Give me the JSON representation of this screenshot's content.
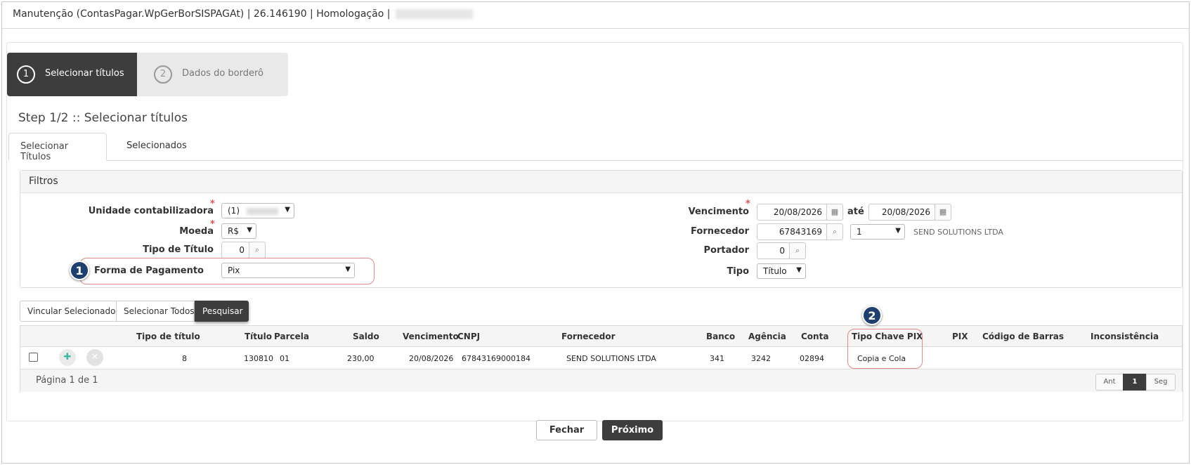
{
  "window": {
    "title": "Manutenção (ContasPagar.WpGerBorSISPAGAt) | 26.146190 | Homologação |"
  },
  "steps": [
    {
      "number": "1",
      "label": "Selecionar títulos"
    },
    {
      "number": "2",
      "label": "Dados do borderô"
    }
  ],
  "step_heading": "Step 1/2 :: Selecionar títulos",
  "tabs": [
    {
      "label": "Selecionar Títulos",
      "active": true
    },
    {
      "label": "Selecionados",
      "active": false
    }
  ],
  "filters": {
    "title": "Filtros",
    "required_mark": "*",
    "unidade": {
      "label": "Unidade contabilizadora",
      "value": "(1)"
    },
    "moeda": {
      "label": "Moeda",
      "value": "R$"
    },
    "tipo_titulo": {
      "label": "Tipo de Título",
      "value": "0"
    },
    "forma_pagamento": {
      "label": "Forma de Pagamento",
      "value": "Pix"
    },
    "vencimento": {
      "label": "Vencimento",
      "from": "20/08/2026",
      "ate_label": "até",
      "to": "20/08/2026"
    },
    "fornecedor": {
      "label": "Fornecedor",
      "code": "67843169",
      "seq": "1",
      "name": "SEND SOLUTIONS LTDA"
    },
    "portador": {
      "label": "Portador",
      "value": "0"
    },
    "tipo": {
      "label": "Tipo",
      "value": "Título"
    }
  },
  "markers": {
    "one": "1",
    "two": "2"
  },
  "actions": {
    "vincular": "Vincular Selecionados",
    "selecionar_todos": "Selecionar Todos",
    "pesquisar": "Pesquisar"
  },
  "grid": {
    "headers": {
      "tipo_titulo": "Tipo de título",
      "titulo": "Título",
      "parcela": "Parcela",
      "saldo": "Saldo",
      "vencimento": "Vencimento",
      "cnpj": "CNPJ",
      "fornecedor": "Fornecedor",
      "banco": "Banco",
      "agencia": "Agência",
      "conta": "Conta",
      "tipo_chave_pix": "Tipo Chave PIX",
      "pix": "PIX",
      "codigo_barras": "Código de Barras",
      "inconsistencia": "Inconsistência"
    },
    "rows": [
      {
        "tipo_titulo": "8",
        "titulo": "130810",
        "parcela": "01",
        "saldo": "230,00",
        "vencimento": "20/08/2026",
        "cnpj": "67843169000184",
        "fornecedor": "SEND SOLUTIONS LTDA",
        "banco": "341",
        "agencia": "3242",
        "conta": "02894",
        "tipo_chave_pix": "Copia e Cola"
      }
    ],
    "page_info": "Página 1 de 1",
    "pager": {
      "prev": "Ant",
      "current": "1",
      "next": "Seg"
    }
  },
  "footer": {
    "fechar": "Fechar",
    "proximo": "Próximo"
  },
  "colors": {
    "dark": "#3d3d3d",
    "accent_marker": "#1f3f6e",
    "highlight": "#e08a8a",
    "required": "#d9534f"
  }
}
